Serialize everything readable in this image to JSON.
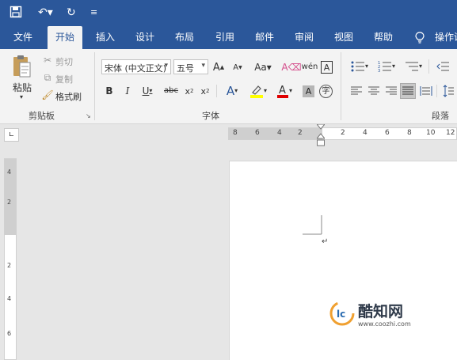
{
  "quick_access": {
    "save_icon": "save-icon",
    "undo_icon": "undo-icon",
    "redo_icon": "redo-icon",
    "customize_icon": "customize-icon"
  },
  "tabs": [
    {
      "label": "文件"
    },
    {
      "label": "开始"
    },
    {
      "label": "插入"
    },
    {
      "label": "设计"
    },
    {
      "label": "布局"
    },
    {
      "label": "引用"
    },
    {
      "label": "邮件"
    },
    {
      "label": "审阅"
    },
    {
      "label": "视图"
    },
    {
      "label": "帮助"
    }
  ],
  "tell_me": "操作说",
  "clipboard": {
    "paste": "粘贴",
    "cut": "剪切",
    "copy": "复制",
    "format_painter": "格式刷",
    "group_label": "剪贴板"
  },
  "font": {
    "font_name": "宋体 (中文正文)",
    "font_size": "五号",
    "group_label": "字体"
  },
  "paragraph": {
    "group_label": "段落"
  },
  "ruler": {
    "h_left": [
      "8",
      "6",
      "4",
      "2"
    ],
    "h_right": [
      "2",
      "4",
      "6",
      "8",
      "10",
      "12"
    ],
    "v": [
      "4",
      "2",
      "2",
      "4",
      "6"
    ]
  },
  "watermark": {
    "brand": "酷知网",
    "url": "www.coozhi.com"
  },
  "colors": {
    "accent": "#2b579a",
    "ribbon": "#f3f3f3",
    "highlight": "#ffff00",
    "font_color": "#e00000"
  }
}
